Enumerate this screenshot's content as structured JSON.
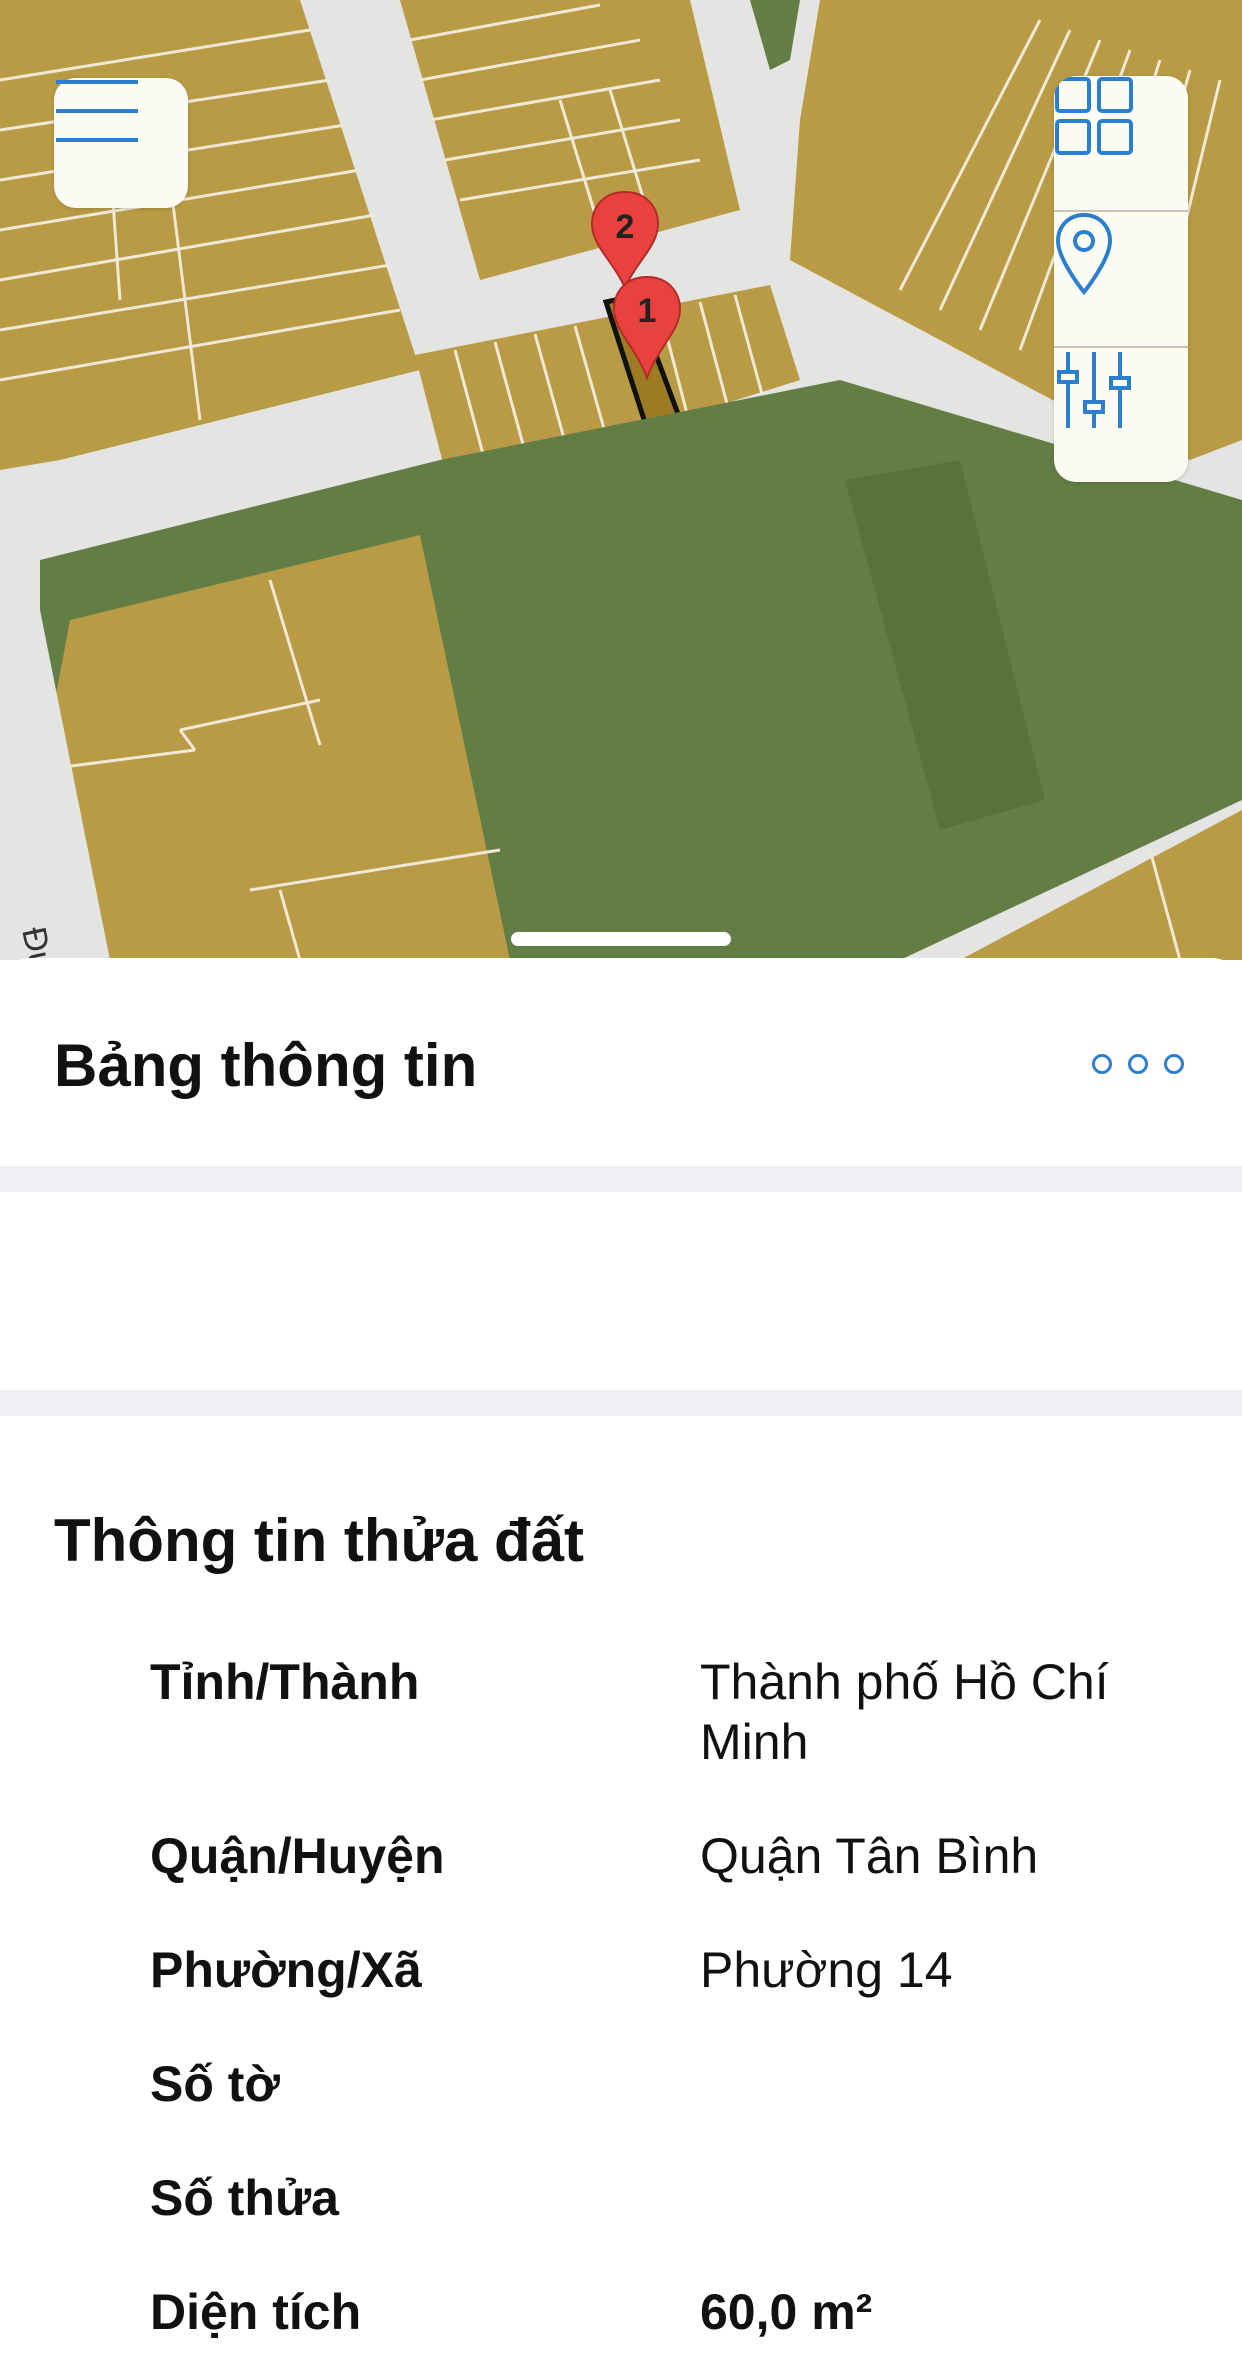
{
  "map": {
    "street_label": "Đườn",
    "markers": [
      {
        "number": "2",
        "color": "#e8413e"
      },
      {
        "number": "1",
        "color": "#e8413e"
      }
    ],
    "colors": {
      "residential": "#b99a45",
      "green": "#627e45",
      "road": "#e3e3e1",
      "accent": "#2a7fcf"
    },
    "controls": {
      "menu_icon": "hamburger-menu-icon",
      "layers_icon": "grid-layers-icon",
      "location_icon": "location-pin-icon",
      "filter_icon": "sliders-icon"
    }
  },
  "info_panel": {
    "title": "Bảng thông tin",
    "more_icon": "more-horizontal-icon"
  },
  "parcel": {
    "section_title": "Thông tin thửa đất",
    "rows": [
      {
        "label": "Tỉnh/Thành",
        "value": "Thành phố Hồ Chí Minh"
      },
      {
        "label": "Quận/Huyện",
        "value": "Quận Tân Bình"
      },
      {
        "label": "Phường/Xã",
        "value": "Phường 14"
      },
      {
        "label": "Số tờ",
        "value": ""
      },
      {
        "label": "Số thửa",
        "value": ""
      },
      {
        "label": "Diện tích",
        "value": "60,0 m²"
      }
    ]
  }
}
